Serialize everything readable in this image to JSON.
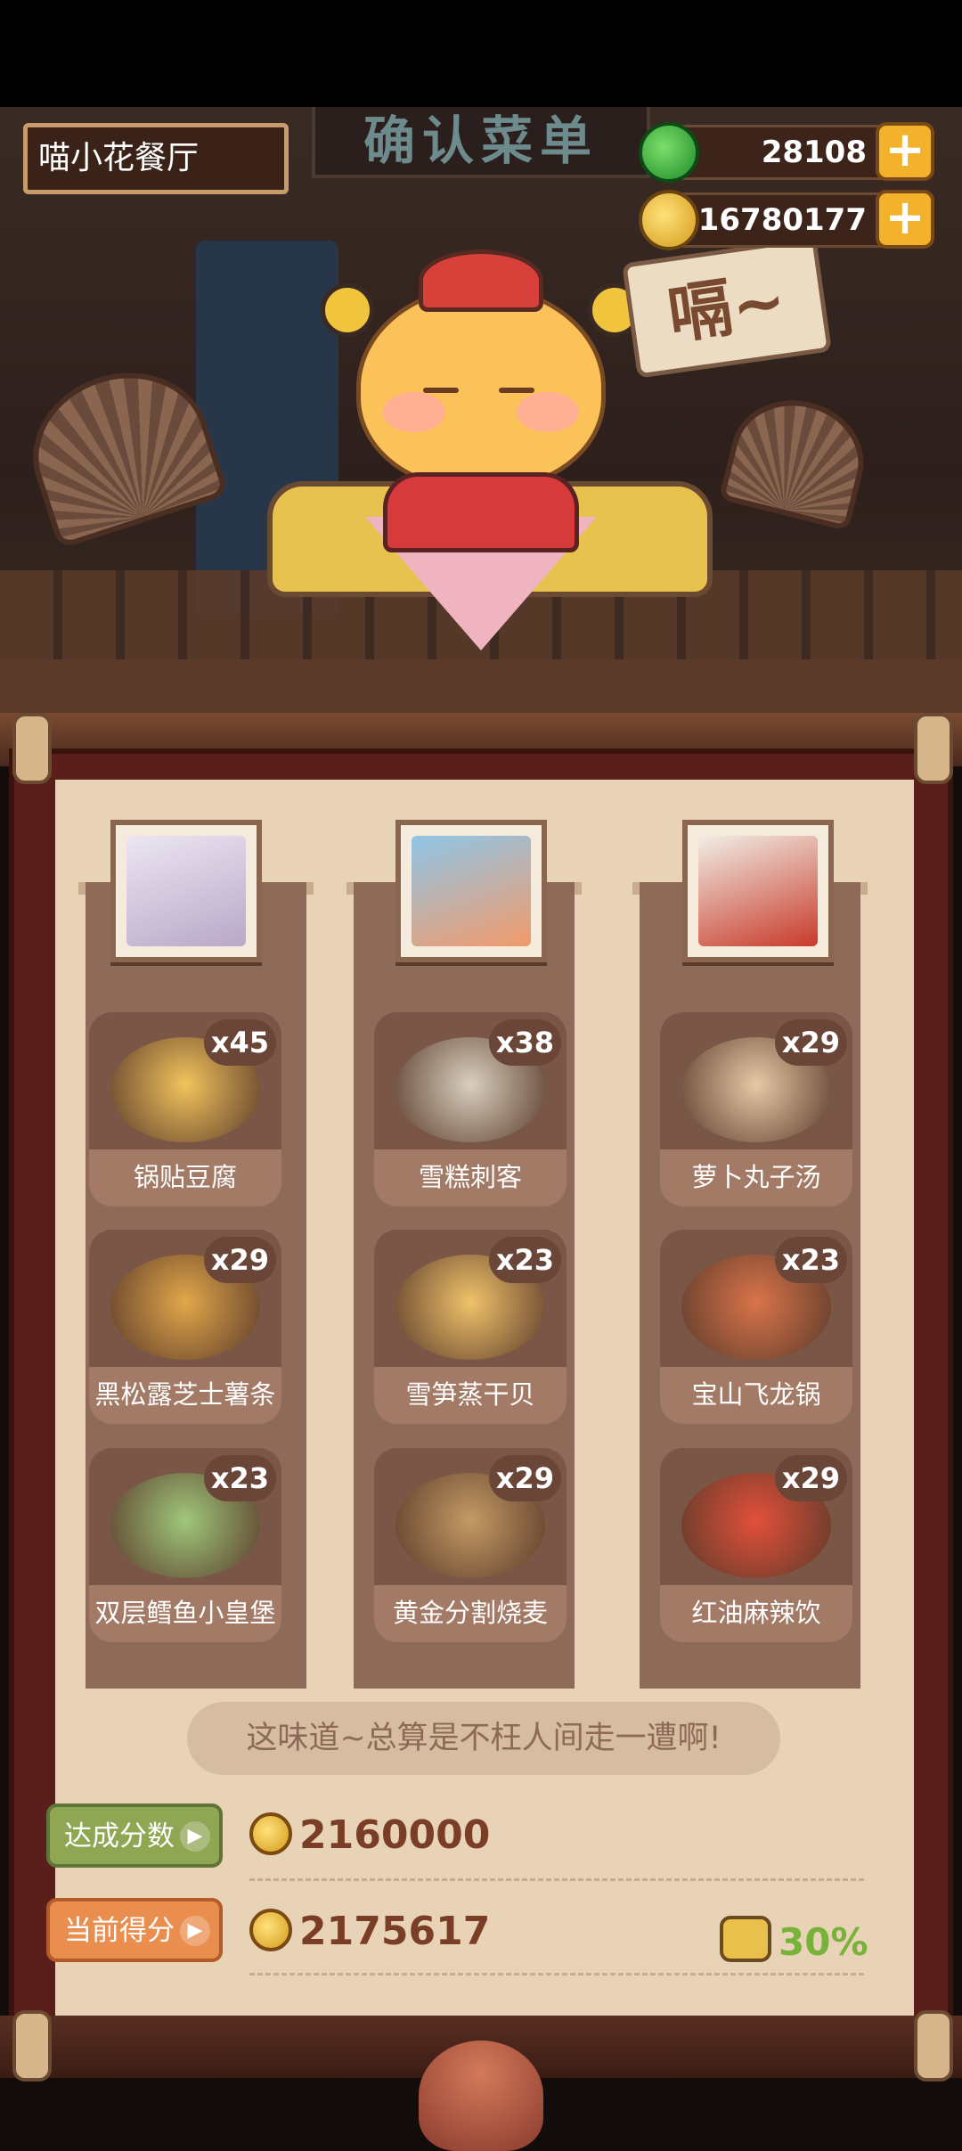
{
  "restaurant_name": "喵小花餐厅",
  "sign_text": "确认菜单",
  "speech_text": "嗝~",
  "resources": {
    "jade": {
      "value": "28108",
      "icon": "jade-icon",
      "plus": "+"
    },
    "coins": {
      "value": "16780177",
      "icon": "coin-icon",
      "plus": "+"
    }
  },
  "columns": [
    {
      "portrait": "character-portrait-silver-hair",
      "dishes": [
        {
          "name": "锅贴豆腐",
          "qty": "x45",
          "color": "#f2c35c"
        },
        {
          "name": "黑松露芝士薯条",
          "qty": "x29",
          "color": "#e2a74a"
        },
        {
          "name": "双层鳕鱼小皇堡",
          "qty": "x23",
          "color": "#9fc77a"
        }
      ]
    },
    {
      "portrait": "character-portrait-orange-hair",
      "dishes": [
        {
          "name": "雪糕刺客",
          "qty": "x38",
          "color": "#d9cfbf"
        },
        {
          "name": "雪笋蒸干贝",
          "qty": "x23",
          "color": "#f0c26a"
        },
        {
          "name": "黄金分割烧麦",
          "qty": "x29",
          "color": "#c49a64"
        }
      ]
    },
    {
      "portrait": "character-portrait-white-hair-panda",
      "dishes": [
        {
          "name": "萝卜丸子汤",
          "qty": "x29",
          "color": "#e6c9a6"
        },
        {
          "name": "宝山飞龙锅",
          "qty": "x23",
          "color": "#d9744a"
        },
        {
          "name": "红油麻辣饮",
          "qty": "x29",
          "color": "#e2503a"
        }
      ]
    }
  ],
  "quote": "这味道~总算是不枉人间走一遭啊!",
  "target": {
    "label": "达成分数",
    "value": "2160000"
  },
  "current": {
    "label": "当前得分",
    "value": "2175617",
    "bonus": "30%"
  }
}
